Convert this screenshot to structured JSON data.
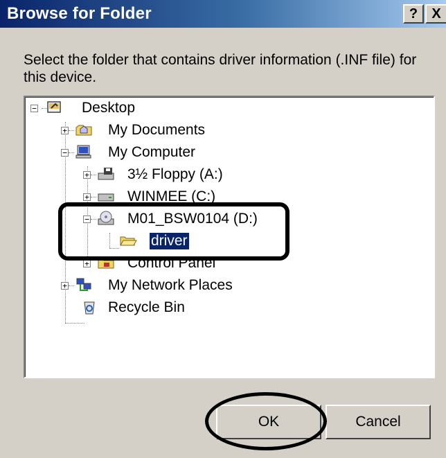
{
  "window": {
    "title": "Browse for Folder",
    "help_label": "?",
    "close_label": "X"
  },
  "instruction": "Select the folder that contains driver information (.INF file) for this device.",
  "tree": {
    "items": [
      {
        "label": "Desktop",
        "icon": "desktop-icon",
        "expander": "−"
      },
      {
        "label": "My Documents",
        "icon": "my-documents-icon",
        "expander": "+"
      },
      {
        "label": "My Computer",
        "icon": "my-computer-icon",
        "expander": "−"
      },
      {
        "label": "3½ Floppy (A:)",
        "icon": "floppy-drive-icon",
        "expander": "+"
      },
      {
        "label": "WINMEE (C:)",
        "icon": "hard-drive-icon",
        "expander": "+"
      },
      {
        "label": "M01_BSW0104 (D:)",
        "icon": "cd-drive-icon",
        "expander": "−"
      },
      {
        "label": "driver",
        "icon": "folder-open-icon",
        "selected": true
      },
      {
        "label": "Control Panel",
        "icon": "control-panel-icon",
        "expander": "+"
      },
      {
        "label": "My Network Places",
        "icon": "network-places-icon",
        "expander": "+"
      },
      {
        "label": "Recycle Bin",
        "icon": "recycle-bin-icon"
      }
    ]
  },
  "buttons": {
    "ok": "OK",
    "cancel": "Cancel"
  },
  "colors": {
    "titlebar_start": "#0a246a",
    "titlebar_end": "#a6caf0",
    "dialog_face": "#d4d0c8",
    "selection": "#0a246a",
    "annotation": "#000000"
  }
}
